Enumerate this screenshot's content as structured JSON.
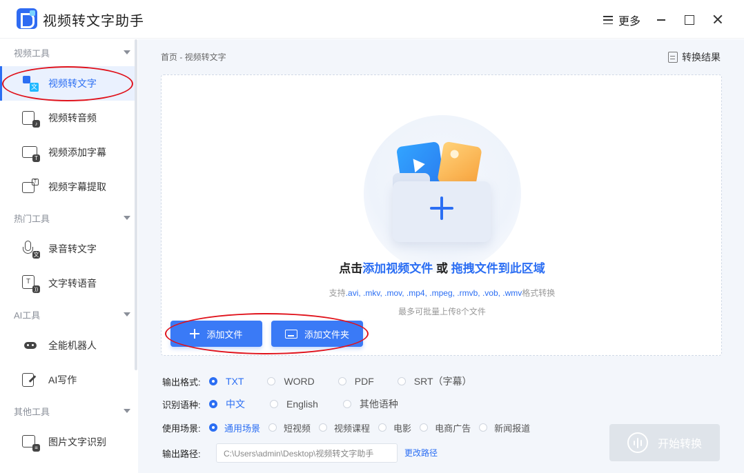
{
  "app": {
    "title": "视频转文字助手",
    "more_label": "更多"
  },
  "sidebar": {
    "sections": [
      {
        "label": "视频工具",
        "items": [
          {
            "label": "视频转文字",
            "icon": "video-to-text-icon",
            "active": true
          },
          {
            "label": "视频转音频",
            "icon": "video-to-audio-icon"
          },
          {
            "label": "视频添加字幕",
            "icon": "add-subtitle-icon"
          },
          {
            "label": "视频字幕提取",
            "icon": "subtitle-extract-icon"
          }
        ]
      },
      {
        "label": "热门工具",
        "items": [
          {
            "label": "录音转文字",
            "icon": "microphone-icon"
          },
          {
            "label": "文字转语音",
            "icon": "text-to-speech-icon"
          }
        ]
      },
      {
        "label": "AI工具",
        "items": [
          {
            "label": "全能机器人",
            "icon": "robot-icon"
          },
          {
            "label": "AI写作",
            "icon": "ai-writing-icon"
          }
        ]
      },
      {
        "label": "其他工具",
        "items": [
          {
            "label": "图片文字识别",
            "icon": "image-ocr-icon"
          }
        ]
      }
    ]
  },
  "main": {
    "breadcrumb": "首页 - 视频转文字",
    "results_label": "转换结果",
    "dropzone": {
      "headline_prefix": "点击",
      "headline_link1": "添加视频文件",
      "headline_or": " 或 ",
      "headline_link2": "拖拽文件到此区域",
      "support_prefix": "支持",
      "support_formats": ".avi, .mkv, .mov, .mp4, .mpeg, .rmvb, .vob, .wmv",
      "support_suffix": "格式转换",
      "limit_text": "最多可批量上传8个文件"
    },
    "buttons": {
      "add_file": "添加文件",
      "add_folder": "添加文件夹",
      "start": "开始转换"
    },
    "options": {
      "format": {
        "label": "输出格式:",
        "choices": [
          "TXT",
          "WORD",
          "PDF",
          "SRT（字幕）"
        ],
        "selected": "TXT"
      },
      "language": {
        "label": "识别语种:",
        "choices": [
          "中文",
          "English",
          "其他语种"
        ],
        "selected": "中文"
      },
      "scene": {
        "label": "使用场景:",
        "choices": [
          "通用场景",
          "短视频",
          "视频课程",
          "电影",
          "电商广告",
          "新闻报道"
        ],
        "selected": "通用场景"
      },
      "path": {
        "label": "输出路径:",
        "value": "C:\\Users\\admin\\Desktop\\视频转文字助手",
        "change_label": "更改路径"
      }
    }
  },
  "colors": {
    "accent": "#2b6ef3",
    "annotation": "#e0121b",
    "disabled": "#dfe4ea"
  }
}
